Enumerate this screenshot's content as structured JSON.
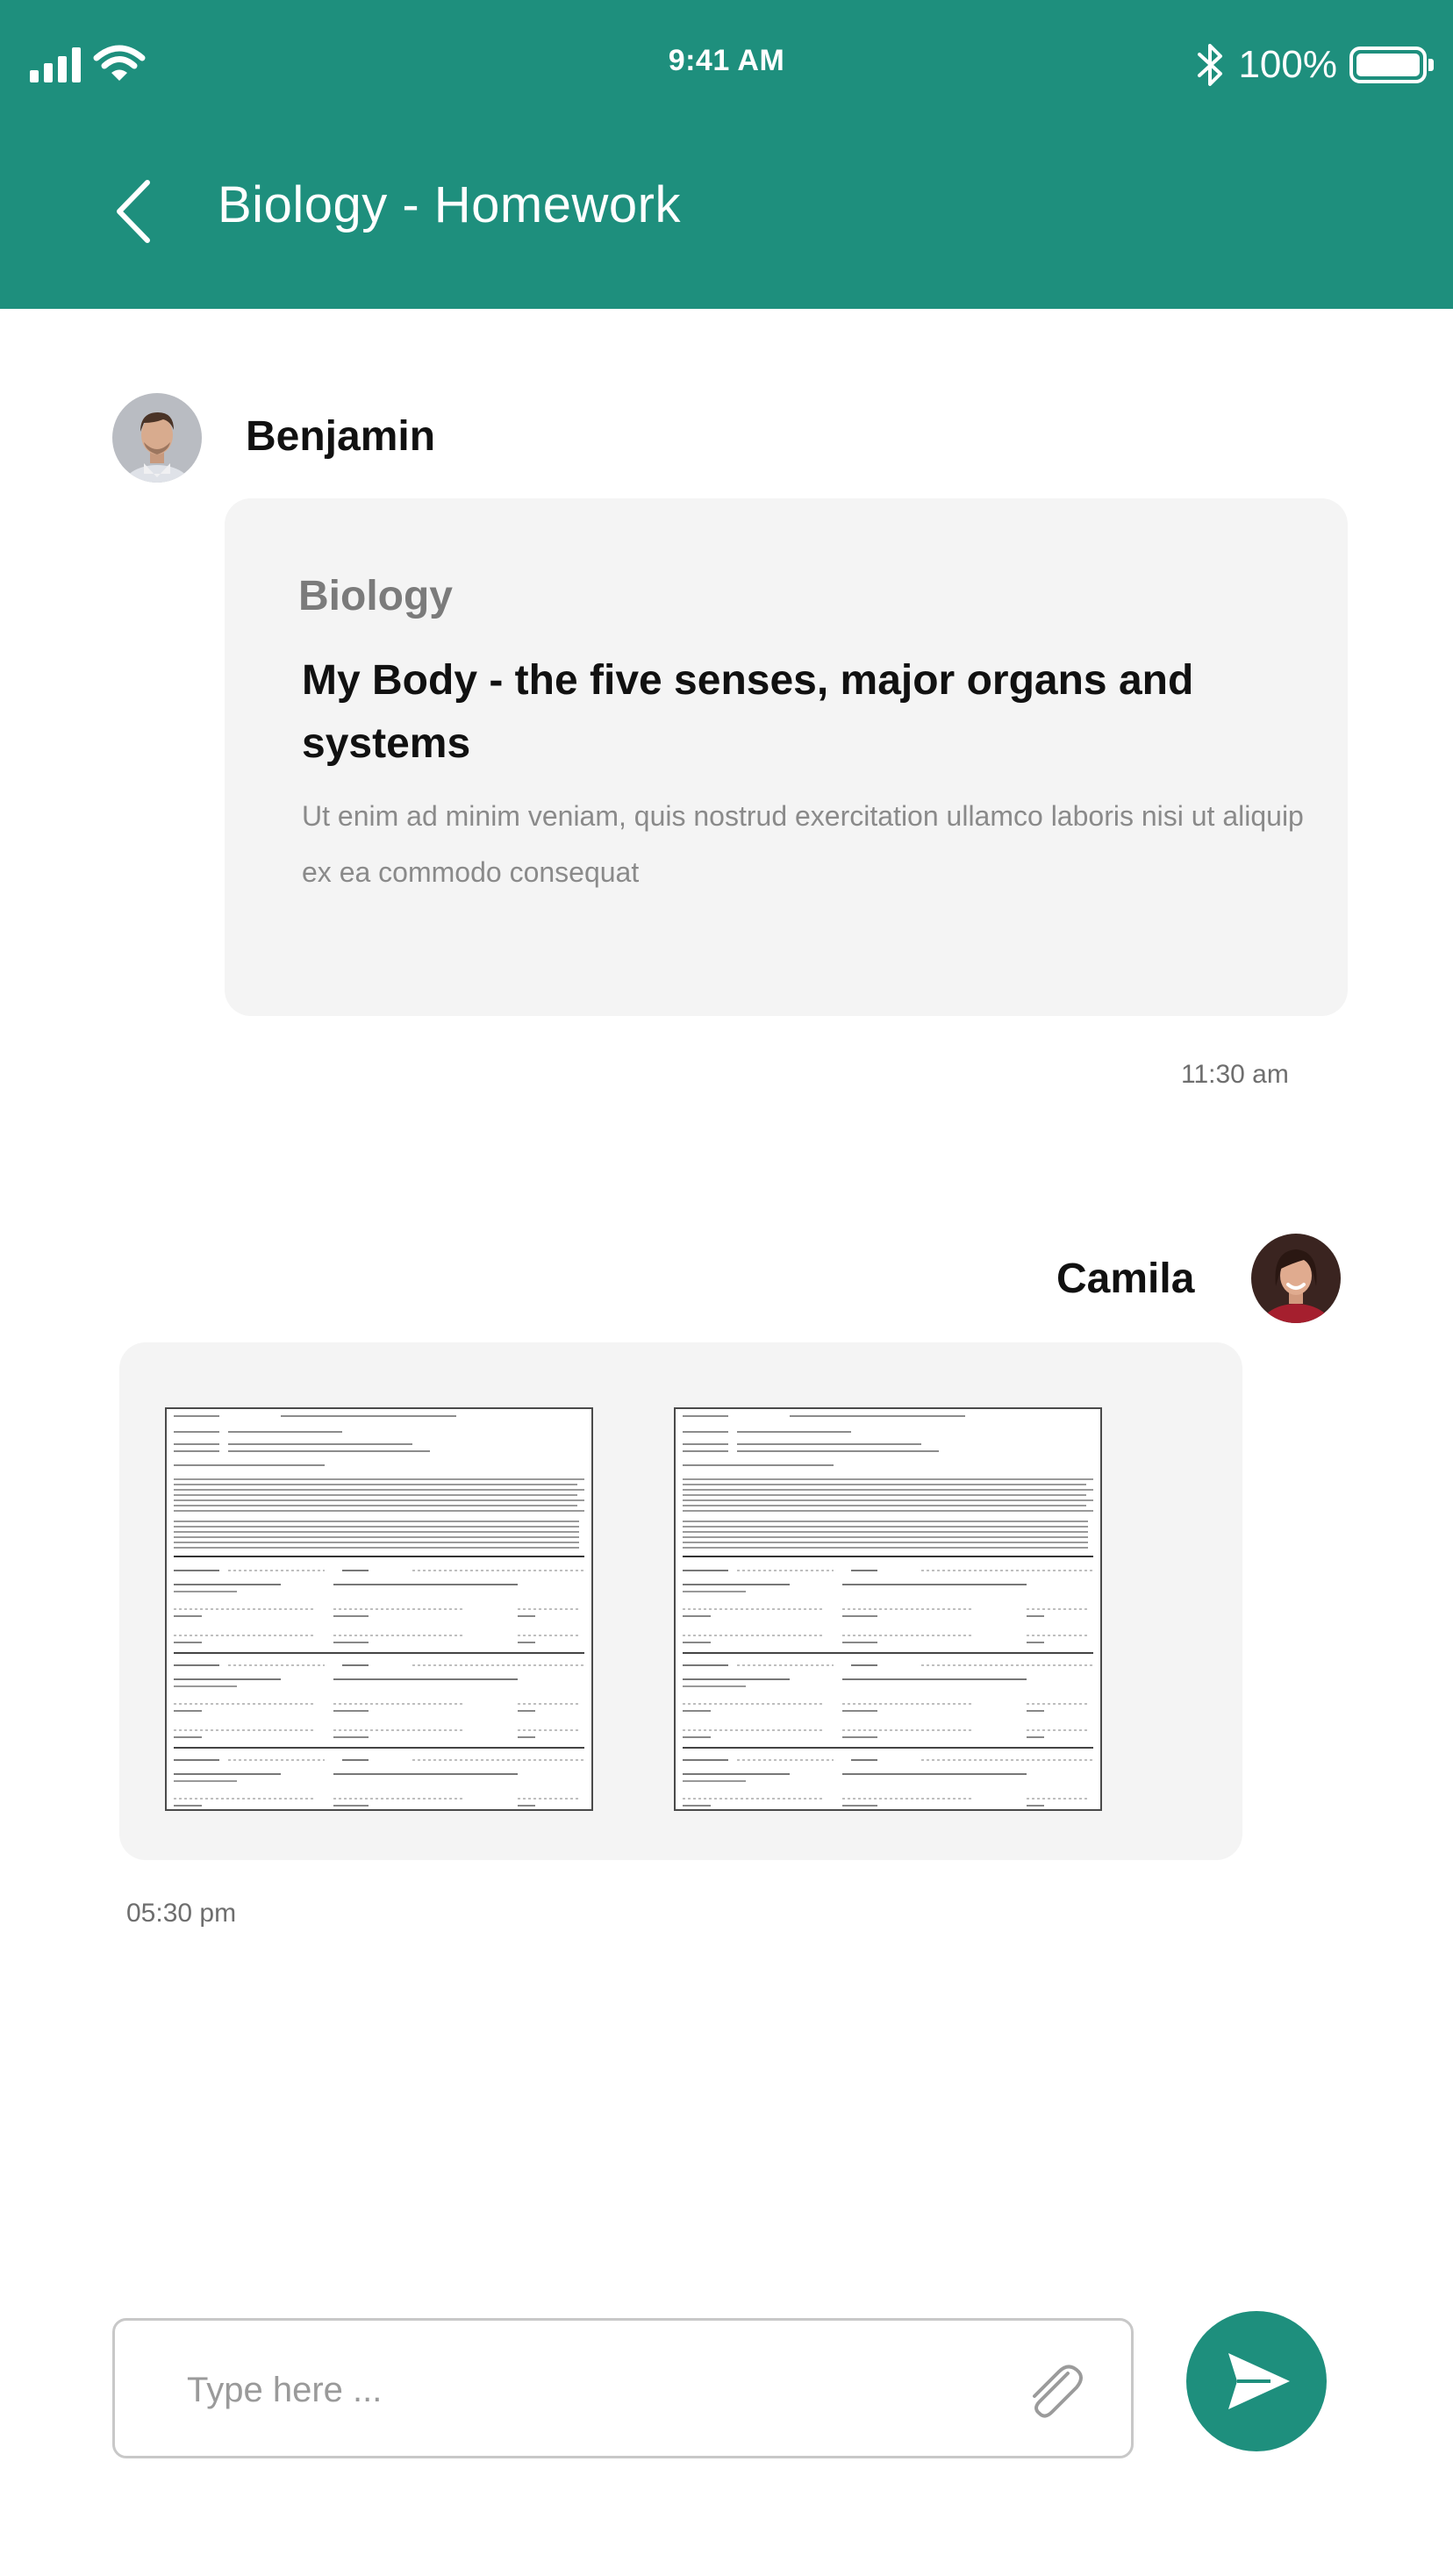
{
  "colors": {
    "brand": "#1e8f7d",
    "bubble": "#f4f4f4",
    "muted_text": "#8a8a8a"
  },
  "status_bar": {
    "time": "9:41 AM",
    "battery": "100%",
    "battery_level": 1.0,
    "icons": [
      "signal-icon",
      "wifi-icon",
      "bluetooth-icon",
      "battery-icon"
    ]
  },
  "header": {
    "title": "Biology - Homework",
    "back_icon": "chevron-left-icon"
  },
  "messages": [
    {
      "sender": "Benjamin",
      "avatar": "avatar-benjamin",
      "subject": "Biology",
      "title": "My Body - the five senses, major organs and systems",
      "description": "Ut enim ad minim veniam, quis nostrud exercitation ullamco laboris nisi ut aliquip ex ea commodo consequat",
      "time": "11:30 am"
    },
    {
      "sender": "Camila",
      "avatar": "avatar-camila",
      "attachments": [
        {
          "type": "document-thumbnail"
        },
        {
          "type": "document-thumbnail"
        }
      ],
      "time": "05:30 pm"
    }
  ],
  "composer": {
    "placeholder": "Type here ...",
    "value": "",
    "attach_icon": "paperclip-icon",
    "send_icon": "send-icon"
  }
}
